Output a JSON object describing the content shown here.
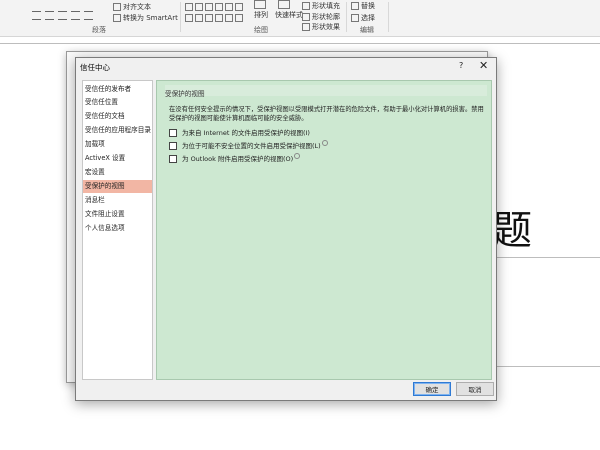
{
  "ribbon": {
    "align_text": "对齐文本",
    "smartart": "转换为 SmartArt",
    "paragraph_group": "段落",
    "arrange": "排列",
    "quick_styles": "快速样式",
    "shape_fill": "形状填充",
    "shape_outline": "形状轮廓",
    "shape_effects": "形状效果",
    "drawing_group": "绘图",
    "replace": "替换",
    "select": "选择",
    "editing_group": "编辑"
  },
  "slide": {
    "title_char": "题"
  },
  "dialog": {
    "title": "信任中心",
    "help": "?",
    "close": "✕",
    "nav": [
      "受信任的发布者",
      "受信任位置",
      "受信任的文档",
      "受信任的应用程序目录",
      "加载项",
      "ActiveX 设置",
      "宏设置",
      "受保护的视图",
      "消息栏",
      "文件阻止设置",
      "个人信息选项"
    ],
    "active_index": 7,
    "section_title": "受保护的视图",
    "description": "在没有任何安全提示的情况下，受保护视图以受限模式打开潜在的危险文件，有助于最小化对计算机的损害。禁用受保护的视图可能使计算机面临可能的安全威胁。",
    "options": [
      {
        "label": "为来自 Internet 的文件启用受保护的视图(I)",
        "checked": false
      },
      {
        "label": "为位于可能不安全位置的文件启用受保护视图(L)",
        "checked": false
      },
      {
        "label": "为 Outlook 附件启用受保护的视图(O)",
        "checked": false
      }
    ],
    "ok_label": "确定",
    "cancel_label": "取消"
  },
  "colors": {
    "content_bg": "#cde8d1",
    "active_nav": "#f2b6a4",
    "ok_border": "#2f7ad4"
  }
}
